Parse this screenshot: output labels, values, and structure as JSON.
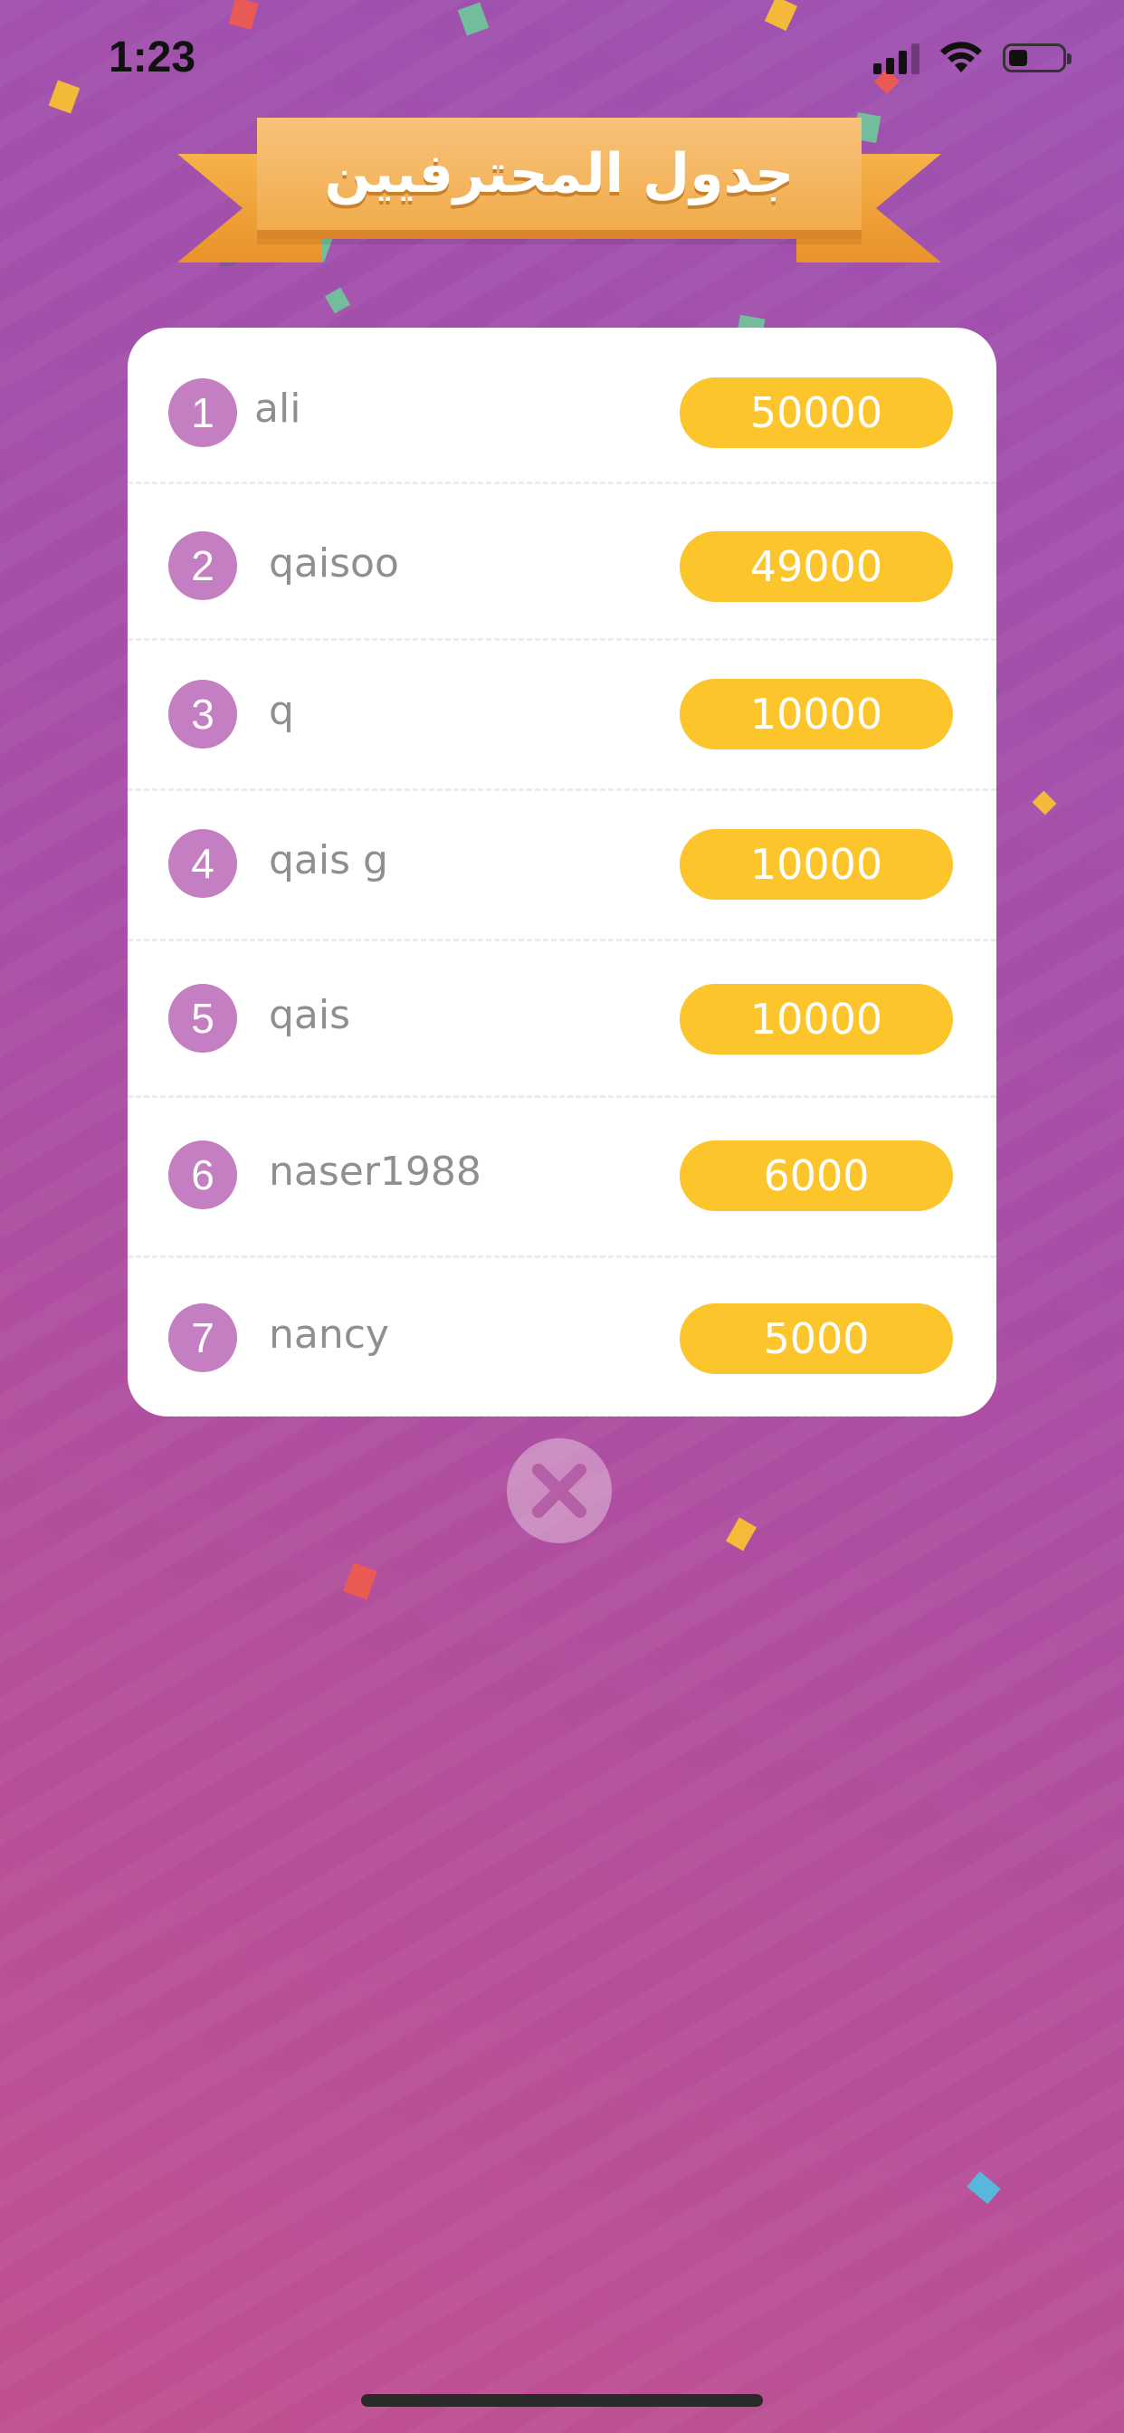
{
  "status_bar": {
    "time": "1:23",
    "icons": [
      "cellular-signal-icon",
      "wifi-icon",
      "battery-icon"
    ],
    "battery_level": 0.35
  },
  "banner": {
    "title": "جدول المحترفيين"
  },
  "leaderboard": [
    {
      "rank": "1",
      "name": "ali",
      "score": "50000"
    },
    {
      "rank": "2",
      "name": "qaisoo",
      "score": "49000"
    },
    {
      "rank": "3",
      "name": "q",
      "score": "10000"
    },
    {
      "rank": "4",
      "name": "qais g",
      "score": "10000"
    },
    {
      "rank": "5",
      "name": "qais",
      "score": "10000"
    },
    {
      "rank": "6",
      "name": "naser1988",
      "score": "6000"
    },
    {
      "rank": "7",
      "name": "nancy",
      "score": "5000"
    }
  ],
  "close_button": {
    "icon": "close-icon"
  },
  "colors": {
    "background_top": "#9e52b0",
    "background_bottom": "#c0508f",
    "rank_badge": "#c47fc2",
    "score_pill": "#fcc52c",
    "banner": "#f1ac4c",
    "name_text": "#8f8f8f"
  }
}
